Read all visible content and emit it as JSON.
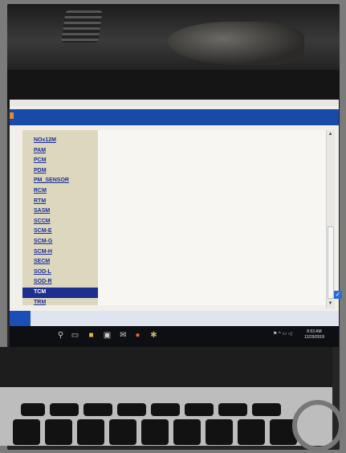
{
  "diagnostic_app": {
    "module_list": {
      "items": [
        {
          "label": "NOx12M",
          "selected": false
        },
        {
          "label": "PAM",
          "selected": false
        },
        {
          "label": "PCM",
          "selected": false
        },
        {
          "label": "PDM",
          "selected": false
        },
        {
          "label": "PM_SENSOR",
          "selected": false
        },
        {
          "label": "RCM",
          "selected": false
        },
        {
          "label": "RTM",
          "selected": false
        },
        {
          "label": "SASM",
          "selected": false
        },
        {
          "label": "SCCM",
          "selected": false
        },
        {
          "label": "SCM-E",
          "selected": false
        },
        {
          "label": "SCM-G",
          "selected": false
        },
        {
          "label": "SCM-H",
          "selected": false
        },
        {
          "label": "SECM",
          "selected": false
        },
        {
          "label": "SOD-L",
          "selected": false
        },
        {
          "label": "SOD-R",
          "selected": false
        },
        {
          "label": "TCM",
          "selected": true
        },
        {
          "label": "TRM",
          "selected": false
        }
      ],
      "selected_item": "TCM"
    },
    "colors": {
      "header_bar": "#1a4aa8",
      "list_background": "#ddd8bd",
      "link_text": "#1a2e9b",
      "selected_background": "#1d2f8f"
    }
  },
  "taskbar": {
    "icons": [
      "search-icon",
      "task-view-icon",
      "folder-icon",
      "store-icon",
      "mail-icon",
      "firefox-icon",
      "app-icon"
    ],
    "clock": {
      "time": "8:53 AM",
      "date": "12/29/2018"
    }
  }
}
